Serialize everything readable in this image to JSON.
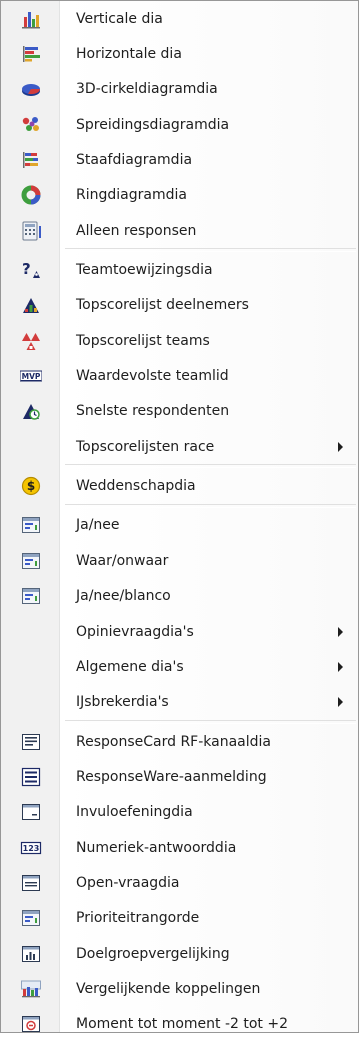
{
  "menu": {
    "items": [
      {
        "label": "Verticale dia",
        "icon": "vertical-bar-chart-icon"
      },
      {
        "label": "Horizontale dia",
        "icon": "horizontal-bar-chart-icon"
      },
      {
        "label": "3D-cirkeldiagramdia",
        "icon": "3d-pie-chart-icon"
      },
      {
        "label": "Spreidingsdiagramdia",
        "icon": "scatter-chart-icon"
      },
      {
        "label": "Staafdiagramdia",
        "icon": "stacked-bar-chart-icon"
      },
      {
        "label": "Ringdiagramdia",
        "icon": "donut-chart-icon"
      },
      {
        "label": "Alleen responsen",
        "icon": "responses-only-icon"
      },
      {
        "label": "Teamtoewijzingsdia",
        "icon": "team-assignment-icon"
      },
      {
        "label": "Topscorelijst deelnemers",
        "icon": "participant-leaderboard-icon"
      },
      {
        "label": "Topscorelijst teams",
        "icon": "team-leaderboard-icon"
      },
      {
        "label": "Waardevolste teamlid",
        "icon": "mvp-icon"
      },
      {
        "label": "Snelste respondenten",
        "icon": "fastest-responders-icon"
      },
      {
        "label": "Topscorelijsten race",
        "icon": ""
      },
      {
        "label": "Weddenschapdia",
        "icon": "wager-coin-icon"
      },
      {
        "label": "Ja/nee",
        "icon": "yes-no-slide-icon"
      },
      {
        "label": "Waar/onwaar",
        "icon": "true-false-slide-icon"
      },
      {
        "label": "Ja/nee/blanco",
        "icon": "yes-no-abstain-slide-icon"
      },
      {
        "label": "Opinievraagdia's",
        "icon": ""
      },
      {
        "label": "Algemene dia's",
        "icon": ""
      },
      {
        "label": "IJsbrekerdia's",
        "icon": ""
      },
      {
        "label": "ResponseCard RF-kanaaldia",
        "icon": "rf-channel-slide-icon"
      },
      {
        "label": "ResponseWare-aanmelding",
        "icon": "responseware-login-icon"
      },
      {
        "label": "Invuloefeningdia",
        "icon": "fill-in-blank-slide-icon"
      },
      {
        "label": "Numeriek-antwoorddia",
        "icon": "numeric-answer-icon"
      },
      {
        "label": "Open-vraagdia",
        "icon": "open-question-slide-icon"
      },
      {
        "label": "Prioriteitrangorde",
        "icon": "priority-ranking-icon"
      },
      {
        "label": "Doelgroepvergelijking",
        "icon": "demographic-comparison-icon"
      },
      {
        "label": "Vergelijkende koppelingen",
        "icon": "comparative-links-icon"
      },
      {
        "label": "Moment tot moment -2 tot +2",
        "icon": "moment-to-moment-icon"
      }
    ],
    "icon_text": {
      "team": "?",
      "mvp": "MVP",
      "coin": "$",
      "numeric": "123"
    },
    "colors": {
      "text": "#1e1e1e",
      "gutter": "#f1f1f1",
      "border": "#979797",
      "separator": "#e0e0e0"
    }
  }
}
